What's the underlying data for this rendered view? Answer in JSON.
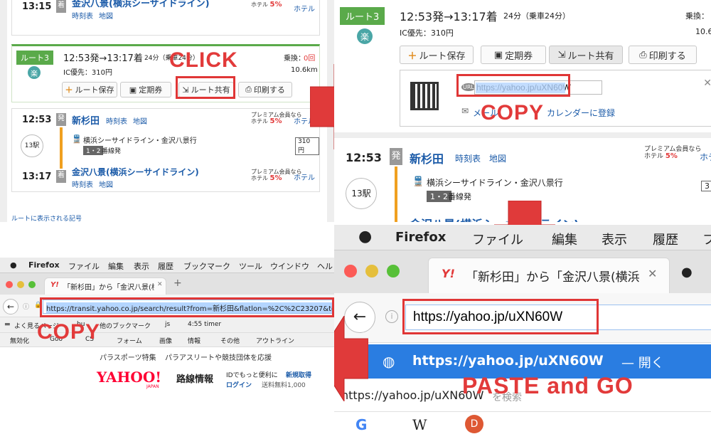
{
  "panel1": {
    "top_route": {
      "time": "13:15",
      "badge": "着",
      "station": "金沢八景(横浜シーサイドライン)",
      "links": [
        "時刻表",
        "地図"
      ],
      "hotel": "ホテル"
    },
    "route": {
      "label": "ルート3",
      "raku": "楽",
      "title": "12:53発→13:17着",
      "duration": "24分（乗車24分）",
      "transfer_label": "乗換：",
      "transfer_value": "0回",
      "fare": "IC優先：310円",
      "distance": "10.6km",
      "buttons": [
        "ルート保存",
        "定期券",
        "ルート共有",
        "印刷する"
      ]
    },
    "dep": {
      "time": "12:53",
      "badge": "発",
      "station": "新杉田",
      "links": [
        "時刻表",
        "地図"
      ],
      "hotel": "ホテル"
    },
    "line": {
      "name": "横浜シーサイドライン・金沢八景行",
      "platform": "1・2",
      "platform_suffix": "番線発",
      "stops": "13駅",
      "fare": "310円"
    },
    "arr": {
      "time": "13:17",
      "badge": "着",
      "station": "金沢八景(横浜シーサイドライン)",
      "links": [
        "時刻表",
        "地図"
      ],
      "hotel": "ホテル"
    },
    "footer_link": "ルートに表示される記号"
  },
  "premium": {
    "line1": "プレミアム会員なら",
    "line2": "ホテル",
    "line3": "予約で",
    "pct": "5%"
  },
  "annotations": {
    "click": "CLICK",
    "copy1": "COPY",
    "copy2": "COPY",
    "paste": "PASTE and GO"
  },
  "panel2": {
    "route": {
      "label": "ルート3",
      "raku": "楽",
      "title": "12:53発→13:17着",
      "duration": "24分（乗車24分）",
      "transfer_label": "乗換：",
      "fare": "IC優先：310円",
      "distance": "10.6",
      "buttons": [
        "ルート保存",
        "定期券",
        "ルート共有",
        "印刷する"
      ]
    },
    "share_url": "https://yahoo.jp/uXN60W",
    "mail": "メール",
    "calendar": "カレンダーに登録",
    "dep": {
      "time": "12:53",
      "badge": "発",
      "station": "新杉田",
      "links": [
        "時刻表",
        "地図"
      ],
      "hotel": "ホテ"
    },
    "line": {
      "name": "横浜シーサイドライン・金沢八景行",
      "platform": "1・2",
      "platform_suffix": "番線発",
      "stops": "13駅",
      "fare": "3"
    },
    "next_station": "金沢八景(横浜シーサイドライン)"
  },
  "panel3": {
    "menubar": [
      "Firefox",
      "ファイル",
      "編集",
      "表示",
      "履歴",
      "ブックマーク",
      "ツール",
      "ウインドウ",
      "ヘル"
    ],
    "tab_title": "「新杉田」から「金沢八景(横浜",
    "url": "https://transit.yahoo.co.jp/search/result?from=新杉田&flatlon=%2C%2C23207&to=金沢",
    "bookmarks1": [
      "よく見るページ",
      "bu",
      "他のブックマーク",
      "js",
      "4:55 timer"
    ],
    "bookmarks2": [
      "無効化",
      "Goo",
      "CS",
      "フォーム",
      "画像",
      "情報",
      "その他",
      "アウトライン"
    ],
    "promo": [
      "パラスポーツ特集",
      "パラアスリートや競技団体を応援"
    ],
    "logo": "YAHOO!",
    "logo_sub": "JAPAN",
    "service": "路線情報",
    "login_text": "IDでもっと便利に",
    "signup": "新規取得",
    "login": "ログイン",
    "shipping": "送料無料1,000"
  },
  "panel4": {
    "menubar": [
      "Firefox",
      "ファイル",
      "編集",
      "表示",
      "履歴",
      "フ"
    ],
    "tab_title": "「新杉田」から「金沢八景(横浜",
    "url": "https://yahoo.jp/uXN60W",
    "suggestion": "https://yahoo.jp/uXN60W",
    "suggestion_action": "— 開く",
    "search_text": "https://yahoo.jp/uXN60W",
    "search_suffix": "を検索",
    "search_engines": [
      "G",
      "W",
      "D"
    ]
  },
  "colors": {
    "accent_red": "#e23a3a",
    "route_green": "#5aaa4a",
    "link_blue": "#1a5aa8",
    "firefox_blue": "#2a7de1"
  }
}
